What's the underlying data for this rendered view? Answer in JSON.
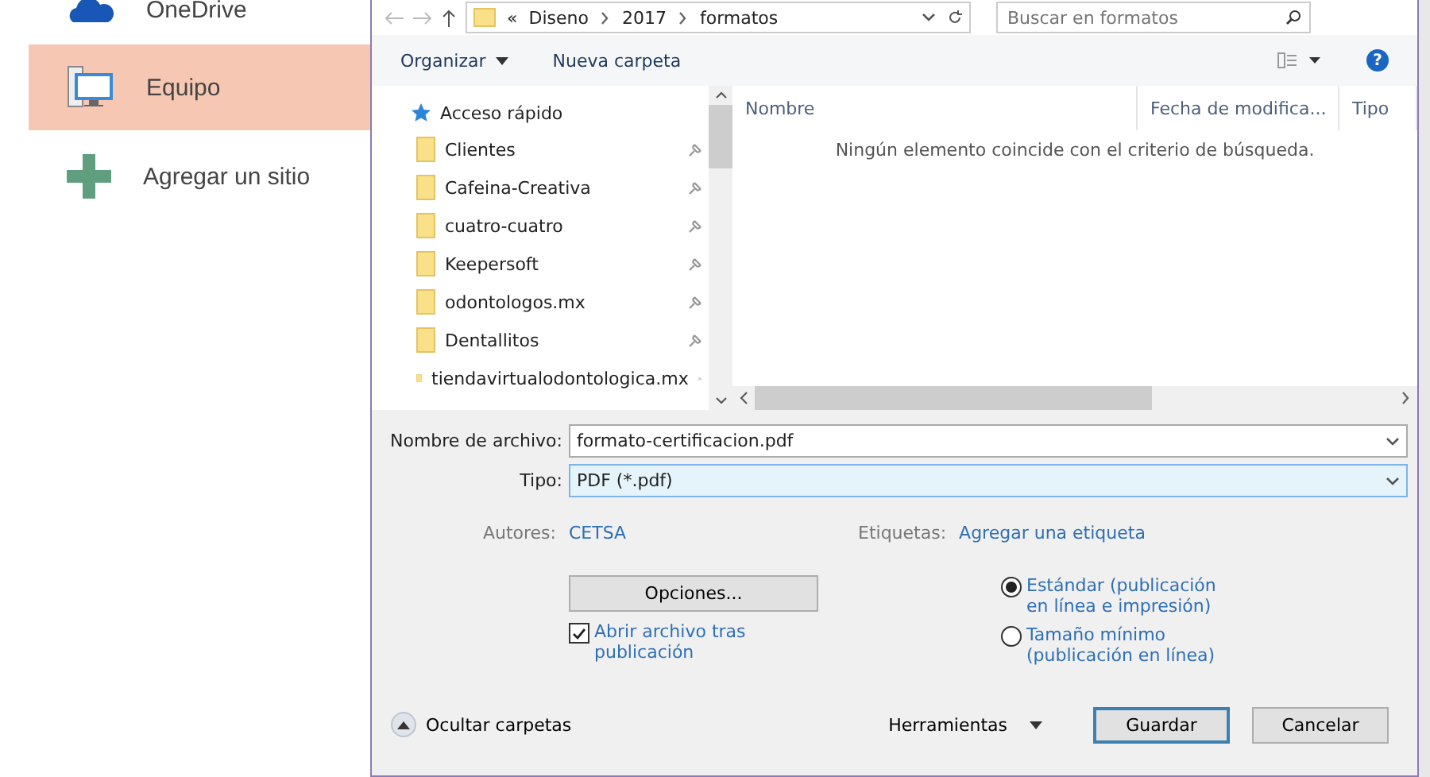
{
  "places": [
    {
      "label": "OneDrive",
      "kind": "cloud",
      "selected": false
    },
    {
      "label": "Equipo",
      "kind": "computer",
      "selected": true
    },
    {
      "label": "Agregar un sitio",
      "kind": "add",
      "selected": false
    }
  ],
  "address": {
    "overflow": "«",
    "path": [
      "Diseno",
      "2017",
      "formatos"
    ],
    "search": {
      "placeholder": "Buscar en formatos"
    }
  },
  "toolbar": {
    "organize": "Organizar",
    "new_folder": "Nueva carpeta",
    "help": "?"
  },
  "nav": {
    "quick_access": "Acceso rápido",
    "folders": [
      "Clientes",
      "Cafeina-Creativa",
      "cuatro-cuatro",
      "Keepersoft",
      "odontologos.mx",
      "Dentallitos",
      "tiendavirtualodontologica.mx"
    ]
  },
  "list": {
    "columns": [
      "Nombre",
      "Fecha de modifica...",
      "Tipo"
    ],
    "empty_message": "Ningún elemento coincide con el criterio de búsqueda."
  },
  "file_name": {
    "label": "Nombre de archivo:",
    "value": "formato-certificacion.pdf"
  },
  "file_type": {
    "label": "Tipo:",
    "value": "PDF (*.pdf)"
  },
  "authors": {
    "label": "Autores:",
    "value": "CETSA"
  },
  "tags": {
    "label": "Etiquetas:",
    "value": "Agregar una etiqueta"
  },
  "options_button": "Opciones...",
  "open_after": {
    "label": "Abrir archivo tras publicación",
    "checked": true
  },
  "optimize": [
    {
      "label": "Estándar (publicación en línea e impresión)",
      "selected": true
    },
    {
      "label": "Tamaño mínimo (publicación en línea)",
      "selected": false
    }
  ],
  "hide_folders": "Ocultar carpetas",
  "tools": "Herramientas",
  "save": "Guardar",
  "cancel": "Cancelar"
}
